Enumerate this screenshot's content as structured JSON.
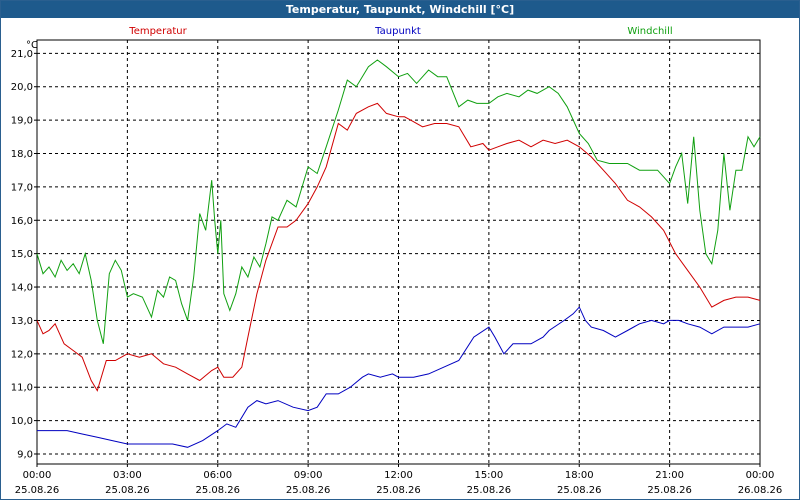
{
  "window_title": "Temperatur, Taupunkt, Windchill [°C]",
  "chart_data": {
    "type": "line",
    "title": "Temperatur, Taupunkt, Windchill [°C]",
    "ylabel": "°C",
    "ylim": [
      8.7,
      21.4
    ],
    "y_ticks": [
      "9,0",
      "10,0",
      "11,0",
      "12,0",
      "13,0",
      "14,0",
      "15,0",
      "16,0",
      "17,0",
      "18,0",
      "19,0",
      "20,0",
      "21,0"
    ],
    "y_tick_values": [
      9,
      10,
      11,
      12,
      13,
      14,
      15,
      16,
      17,
      18,
      19,
      20,
      21
    ],
    "xlim": [
      0,
      24
    ],
    "x_tick_values": [
      0,
      3,
      6,
      9,
      12,
      15,
      18,
      21,
      24
    ],
    "x_ticks": [
      {
        "time": "00:00",
        "date": "25.08.26"
      },
      {
        "time": "03:00",
        "date": "25.08.26"
      },
      {
        "time": "06:00",
        "date": "25.08.26"
      },
      {
        "time": "09:00",
        "date": "25.08.26"
      },
      {
        "time": "12:00",
        "date": "25.08.26"
      },
      {
        "time": "15:00",
        "date": "25.08.26"
      },
      {
        "time": "18:00",
        "date": "25.08.26"
      },
      {
        "time": "21:00",
        "date": "25.08.26"
      },
      {
        "time": "00:00",
        "date": "26.08.26"
      }
    ],
    "grid": true,
    "series": [
      {
        "name": "Temperatur",
        "color": "#d00000",
        "x": [
          0,
          0.2,
          0.4,
          0.6,
          0.9,
          1.2,
          1.5,
          1.8,
          2.0,
          2.3,
          2.6,
          3.0,
          3.4,
          3.8,
          4.2,
          4.6,
          5.0,
          5.4,
          5.8,
          6.0,
          6.2,
          6.5,
          6.8,
          7.0,
          7.3,
          7.6,
          8.0,
          8.3,
          8.6,
          9.0,
          9.3,
          9.6,
          10.0,
          10.3,
          10.6,
          11.0,
          11.3,
          11.6,
          12.0,
          12.2,
          12.4,
          12.8,
          13.2,
          13.6,
          14.0,
          14.4,
          14.8,
          15.0,
          15.3,
          15.6,
          16.0,
          16.4,
          16.8,
          17.2,
          17.6,
          18.0,
          18.4,
          18.8,
          19.2,
          19.6,
          20.0,
          20.4,
          20.8,
          21.2,
          21.6,
          22.0,
          22.4,
          22.8,
          23.2,
          23.6,
          24.0
        ],
        "y": [
          13.0,
          12.6,
          12.7,
          12.9,
          12.3,
          12.1,
          11.9,
          11.2,
          10.9,
          11.8,
          11.8,
          12.0,
          11.9,
          12.0,
          11.7,
          11.6,
          11.4,
          11.2,
          11.5,
          11.6,
          11.3,
          11.3,
          11.6,
          12.5,
          13.8,
          14.8,
          15.8,
          15.8,
          16.0,
          16.5,
          17.0,
          17.6,
          18.9,
          18.7,
          19.2,
          19.4,
          19.5,
          19.2,
          19.1,
          19.1,
          19.0,
          18.8,
          18.9,
          18.9,
          18.8,
          18.2,
          18.3,
          18.1,
          18.2,
          18.3,
          18.4,
          18.2,
          18.4,
          18.3,
          18.4,
          18.2,
          17.9,
          17.5,
          17.1,
          16.6,
          16.4,
          16.1,
          15.7,
          15.0,
          14.5,
          14.0,
          13.4,
          13.6,
          13.7,
          13.7,
          13.6
        ]
      },
      {
        "name": "Taupunkt",
        "color": "#0000c0",
        "x": [
          0,
          0.5,
          1.0,
          1.5,
          2.0,
          2.5,
          3.0,
          3.5,
          4.0,
          4.5,
          5.0,
          5.5,
          6.0,
          6.3,
          6.6,
          7.0,
          7.3,
          7.6,
          8.0,
          8.5,
          9.0,
          9.3,
          9.6,
          10.0,
          10.4,
          10.8,
          11.0,
          11.4,
          11.8,
          12.0,
          12.5,
          13.0,
          13.5,
          14.0,
          14.5,
          15.0,
          15.2,
          15.5,
          15.8,
          16.0,
          16.4,
          16.8,
          17.0,
          17.5,
          17.8,
          18.0,
          18.2,
          18.4,
          18.8,
          19.2,
          19.6,
          20.0,
          20.4,
          20.8,
          21.0,
          21.3,
          21.6,
          22.0,
          22.4,
          22.8,
          23.2,
          23.6,
          24.0
        ],
        "y": [
          9.7,
          9.7,
          9.7,
          9.6,
          9.5,
          9.4,
          9.3,
          9.3,
          9.3,
          9.3,
          9.2,
          9.4,
          9.7,
          9.9,
          9.8,
          10.4,
          10.6,
          10.5,
          10.6,
          10.4,
          10.3,
          10.4,
          10.8,
          10.8,
          11.0,
          11.3,
          11.4,
          11.3,
          11.4,
          11.3,
          11.3,
          11.4,
          11.6,
          11.8,
          12.5,
          12.8,
          12.5,
          12.0,
          12.3,
          12.3,
          12.3,
          12.5,
          12.7,
          13.0,
          13.2,
          13.4,
          13.0,
          12.8,
          12.7,
          12.5,
          12.7,
          12.9,
          13.0,
          12.9,
          13.0,
          13.0,
          12.9,
          12.8,
          12.6,
          12.8,
          12.8,
          12.8,
          12.9
        ]
      },
      {
        "name": "Windchill",
        "color": "#10a010",
        "x": [
          0,
          0.2,
          0.4,
          0.6,
          0.8,
          1.0,
          1.2,
          1.4,
          1.6,
          1.8,
          2.0,
          2.2,
          2.4,
          2.6,
          2.8,
          3.0,
          3.2,
          3.5,
          3.8,
          4.0,
          4.2,
          4.4,
          4.6,
          4.8,
          5.0,
          5.2,
          5.4,
          5.6,
          5.8,
          5.9,
          6.0,
          6.1,
          6.2,
          6.4,
          6.6,
          6.8,
          7.0,
          7.2,
          7.4,
          7.6,
          7.8,
          8.0,
          8.3,
          8.6,
          9.0,
          9.3,
          9.6,
          10.0,
          10.3,
          10.6,
          11.0,
          11.3,
          11.6,
          12.0,
          12.3,
          12.6,
          13.0,
          13.3,
          13.6,
          14.0,
          14.3,
          14.6,
          15.0,
          15.3,
          15.6,
          16.0,
          16.3,
          16.6,
          17.0,
          17.3,
          17.6,
          18.0,
          18.3,
          18.6,
          19.0,
          19.3,
          19.6,
          20.0,
          20.3,
          20.6,
          21.0,
          21.2,
          21.4,
          21.6,
          21.8,
          22.0,
          22.2,
          22.4,
          22.6,
          22.8,
          23.0,
          23.2,
          23.4,
          23.6,
          23.8,
          24.0
        ],
        "y": [
          15.0,
          14.4,
          14.6,
          14.3,
          14.8,
          14.5,
          14.7,
          14.4,
          15.0,
          14.2,
          13.0,
          12.3,
          14.4,
          14.8,
          14.5,
          13.7,
          13.8,
          13.7,
          13.1,
          13.9,
          13.7,
          14.3,
          14.2,
          13.5,
          13.0,
          14.3,
          16.2,
          15.7,
          17.2,
          16.0,
          15.0,
          16.0,
          13.8,
          13.3,
          13.8,
          14.6,
          14.3,
          14.9,
          14.6,
          15.3,
          16.1,
          16.0,
          16.6,
          16.4,
          17.6,
          17.4,
          18.2,
          19.3,
          20.2,
          20.0,
          20.6,
          20.8,
          20.6,
          20.3,
          20.4,
          20.1,
          20.5,
          20.3,
          20.3,
          19.4,
          19.6,
          19.5,
          19.5,
          19.7,
          19.8,
          19.7,
          19.9,
          19.8,
          20.0,
          19.8,
          19.4,
          18.6,
          18.3,
          17.8,
          17.7,
          17.7,
          17.7,
          17.5,
          17.5,
          17.5,
          17.1,
          17.6,
          18.0,
          16.5,
          18.5,
          16.3,
          15.0,
          14.7,
          15.7,
          18.0,
          16.3,
          17.5,
          17.5,
          18.5,
          18.2,
          18.5
        ]
      }
    ]
  }
}
